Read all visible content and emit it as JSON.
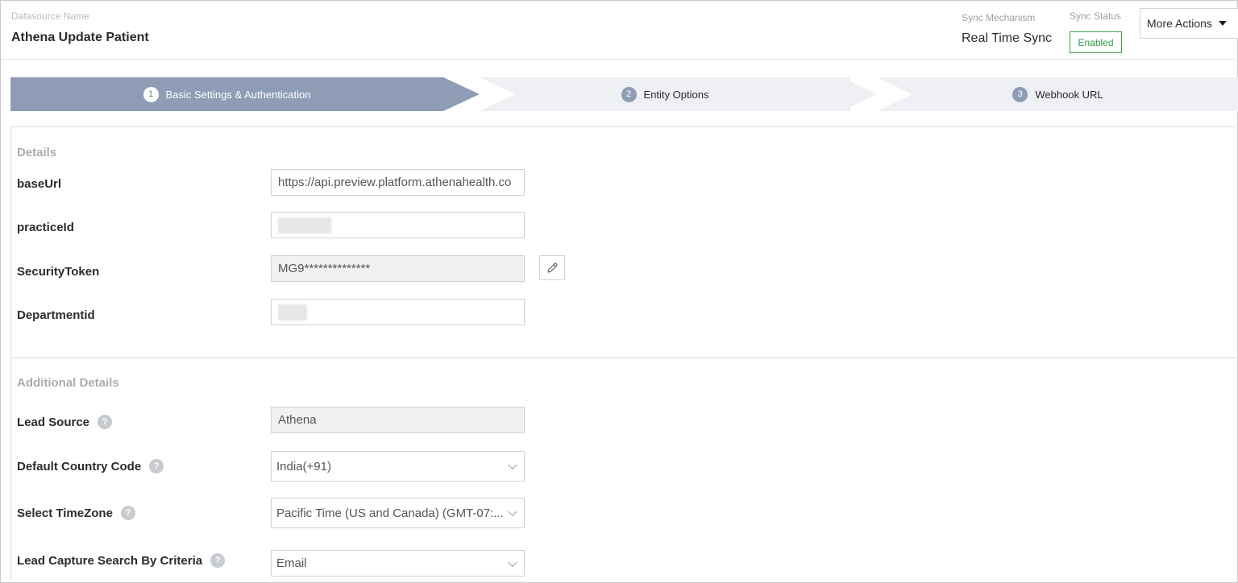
{
  "header": {
    "datasource_name_label": "Datasource Name",
    "datasource_name": "Athena Update Patient",
    "sync_mechanism_label": "Sync Mechanism",
    "sync_mechanism": "Real Time Sync",
    "sync_status_label": "Sync Status",
    "sync_status": "Enabled",
    "more_actions": "More Actions"
  },
  "stepper": {
    "steps": [
      {
        "num": "1",
        "label": "Basic Settings & Authentication",
        "active": true
      },
      {
        "num": "2",
        "label": "Entity Options",
        "active": false
      },
      {
        "num": "3",
        "label": "Webhook URL",
        "active": false
      }
    ]
  },
  "details": {
    "title": "Details",
    "fields": [
      {
        "label": "baseUrl",
        "value": "https://api.preview.platform.athenahealth.co"
      },
      {
        "label": "practiceId",
        "value": ""
      },
      {
        "label": "SecurityToken",
        "value": "MG9**************"
      },
      {
        "label": "Departmentid",
        "value": ""
      }
    ]
  },
  "additional": {
    "title": "Additional Details",
    "fields": [
      {
        "label": "Lead Source",
        "value": "Athena"
      },
      {
        "label": "Default Country Code",
        "value": "India(+91)"
      },
      {
        "label": "Select TimeZone",
        "value": "Pacific Time (US and Canada) (GMT-07:..."
      },
      {
        "label": "Lead Capture Search By Criteria",
        "value": "Email"
      }
    ]
  },
  "icons": {
    "help": "question-mark-icon",
    "edit": "pencil-icon",
    "caret": "caret-down-icon"
  },
  "colors": {
    "active_step": "#8e9db5",
    "inactive_step": "#eef0f3",
    "status_enabled": "#43a047"
  }
}
